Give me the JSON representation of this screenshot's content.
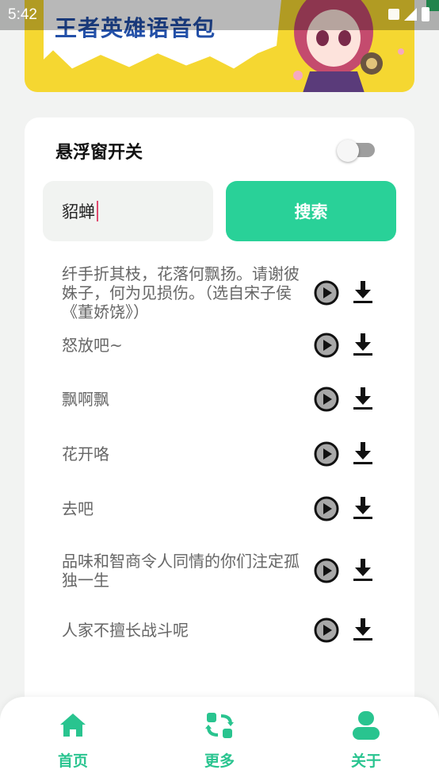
{
  "status_bar": {
    "time": "5:42"
  },
  "banner": {
    "title": "王者英雄语音包"
  },
  "settings": {
    "floating_window_label": "悬浮窗开关",
    "floating_window_on": false
  },
  "search": {
    "value": "貂蝉",
    "button_label": "搜索"
  },
  "voice_lines": [
    {
      "text": "纤手折其枝，花落何飘扬。请谢彼姝子，何为见损伤。（选自宋子侯《董娇饶》）"
    },
    {
      "text": "怒放吧~"
    },
    {
      "text": "飘啊飘"
    },
    {
      "text": "花开咯"
    },
    {
      "text": "去吧"
    },
    {
      "text": "品味和智商令人同情的你们注定孤独一生"
    },
    {
      "text": "人家不擅长战斗呢"
    }
  ],
  "bottom_nav": {
    "items": [
      {
        "label": "首页",
        "icon": "home-icon"
      },
      {
        "label": "更多",
        "icon": "refresh-grid-icon"
      },
      {
        "label": "关于",
        "icon": "user-icon"
      }
    ]
  },
  "colors": {
    "accent": "#29d198",
    "banner_bg": "#f5d731",
    "background": "#f2f3f2"
  }
}
